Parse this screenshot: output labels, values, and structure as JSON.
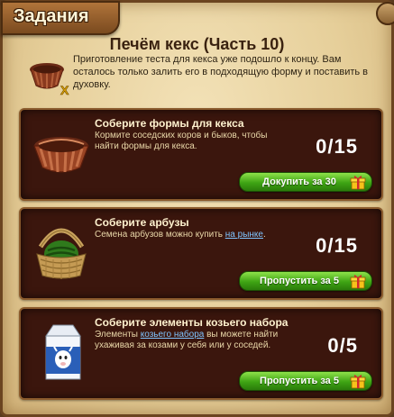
{
  "window": {
    "tab_title": "Задания",
    "quest_title": "Печём кекс (Часть 10)",
    "intro_text": "Приготовление теста для кекса уже подошло к концу. Вам осталось только залить его в подходящую форму и поставить в духовку."
  },
  "tasks": [
    {
      "title": "Соберите формы для кекса",
      "desc_before": "Кормите соседских коров и быков, чтобы найти формы для кекса.",
      "link": "",
      "desc_after": "",
      "count": "0/15",
      "button": "Докупить за 30",
      "icon": "cupcake-mold-icon"
    },
    {
      "title": "Соберите арбузы",
      "desc_before": "Семена арбузов можно купить ",
      "link": "на рынке",
      "desc_after": ".",
      "count": "0/15",
      "button": "Пропустить за 5",
      "icon": "watermelon-basket-icon"
    },
    {
      "title": "Соберите элементы козьего набора",
      "desc_before": "Элементы ",
      "link": "козьего набора",
      "desc_after": " вы можете найти ухаживая за козами у себя или у соседей.",
      "count": "0/5",
      "button": "Пропустить за 5",
      "icon": "goat-milk-carton-icon"
    }
  ],
  "colors": {
    "button_green": "#3ea414",
    "panel_dark": "#3b160d",
    "link_blue": "#7fc4ff"
  }
}
